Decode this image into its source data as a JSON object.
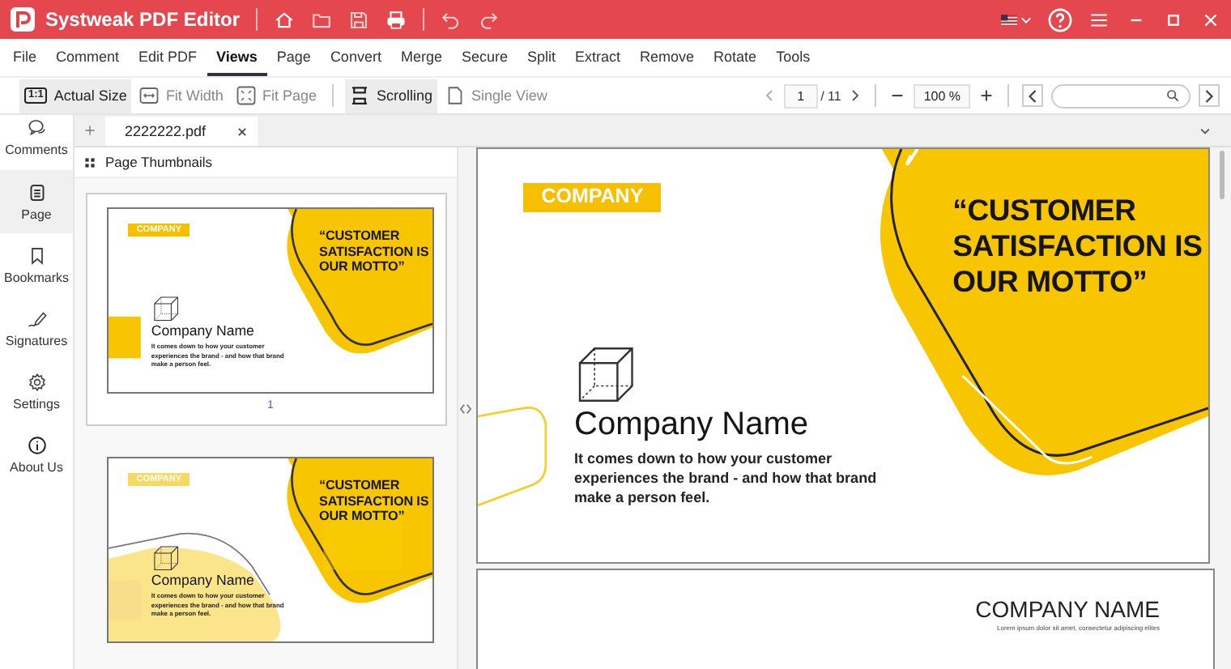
{
  "app": {
    "title": "Systweak PDF Editor"
  },
  "menu": [
    {
      "label": "File",
      "selected": false
    },
    {
      "label": "Comment",
      "selected": false
    },
    {
      "label": "Edit PDF",
      "selected": false
    },
    {
      "label": "Views",
      "selected": true
    },
    {
      "label": "Page",
      "selected": false
    },
    {
      "label": "Convert",
      "selected": false
    },
    {
      "label": "Merge",
      "selected": false
    },
    {
      "label": "Secure",
      "selected": false
    },
    {
      "label": "Split",
      "selected": false
    },
    {
      "label": "Extract",
      "selected": false
    },
    {
      "label": "Remove",
      "selected": false
    },
    {
      "label": "Rotate",
      "selected": false
    },
    {
      "label": "Tools",
      "selected": false
    }
  ],
  "view_tools": [
    {
      "label": "Actual Size",
      "kind": "actual",
      "icon_text": "1:1",
      "selected": true
    },
    {
      "label": "Fit Width",
      "kind": "width",
      "selected": false
    },
    {
      "label": "Fit Page",
      "kind": "page",
      "selected": false
    },
    {
      "label": "Scrolling",
      "kind": "scroll",
      "selected": true
    },
    {
      "label": "Single View",
      "kind": "single",
      "selected": false
    }
  ],
  "pager": {
    "page": "1",
    "total": "/ 11",
    "zoom": "100 %"
  },
  "document_tab": {
    "name": "2222222.pdf"
  },
  "sidebar": [
    {
      "label": "Comments",
      "kind": "comments",
      "selected": false
    },
    {
      "label": "Page",
      "kind": "page",
      "selected": true
    },
    {
      "label": "Bookmarks",
      "kind": "bookmarks",
      "selected": false
    },
    {
      "label": "Signatures",
      "kind": "signatures",
      "selected": false
    },
    {
      "label": "Settings",
      "kind": "settings",
      "selected": false
    },
    {
      "label": "About Us",
      "kind": "about",
      "selected": false
    }
  ],
  "thumbnails": {
    "title": "Page Thumbnails",
    "pages": [
      {
        "kind": "cover",
        "selected": true,
        "number": "1",
        "badge": "COMPANY",
        "quote_lines": [
          "“CUSTOMER",
          "SATISFACTION IS",
          "OUR MOTTO”"
        ],
        "company": "Company Name",
        "tagline_lines": [
          "It comes down to how your customer",
          "experiences the brand - and how that brand",
          "make a person feel."
        ]
      },
      {
        "kind": "overlay",
        "selected": false,
        "badge": "COMPANY",
        "quote_lines": [
          "“CUSTOMER",
          "SATISFACTION IS",
          "OUR MOTTO”"
        ],
        "company": "Company Name",
        "tagline_lines": [
          "It comes down to how your customer",
          "experiences the brand - and how that brand",
          "make a person feel."
        ]
      }
    ]
  },
  "document": {
    "pages": [
      {
        "kind": "cover",
        "badge": "COMPANY",
        "quote_lines": [
          "“CUSTOMER",
          "SATISFACTION IS",
          "OUR MOTTO”"
        ],
        "company": "Company Name",
        "tagline_lines": [
          "It comes down to how your customer",
          "experiences the brand - and how that brand",
          "make a person feel."
        ]
      },
      {
        "kind": "title",
        "heading": "COMPANY NAME",
        "subtext": "Lorem ipsum dolor sit amet, consectetur adipiscing elites"
      }
    ]
  }
}
